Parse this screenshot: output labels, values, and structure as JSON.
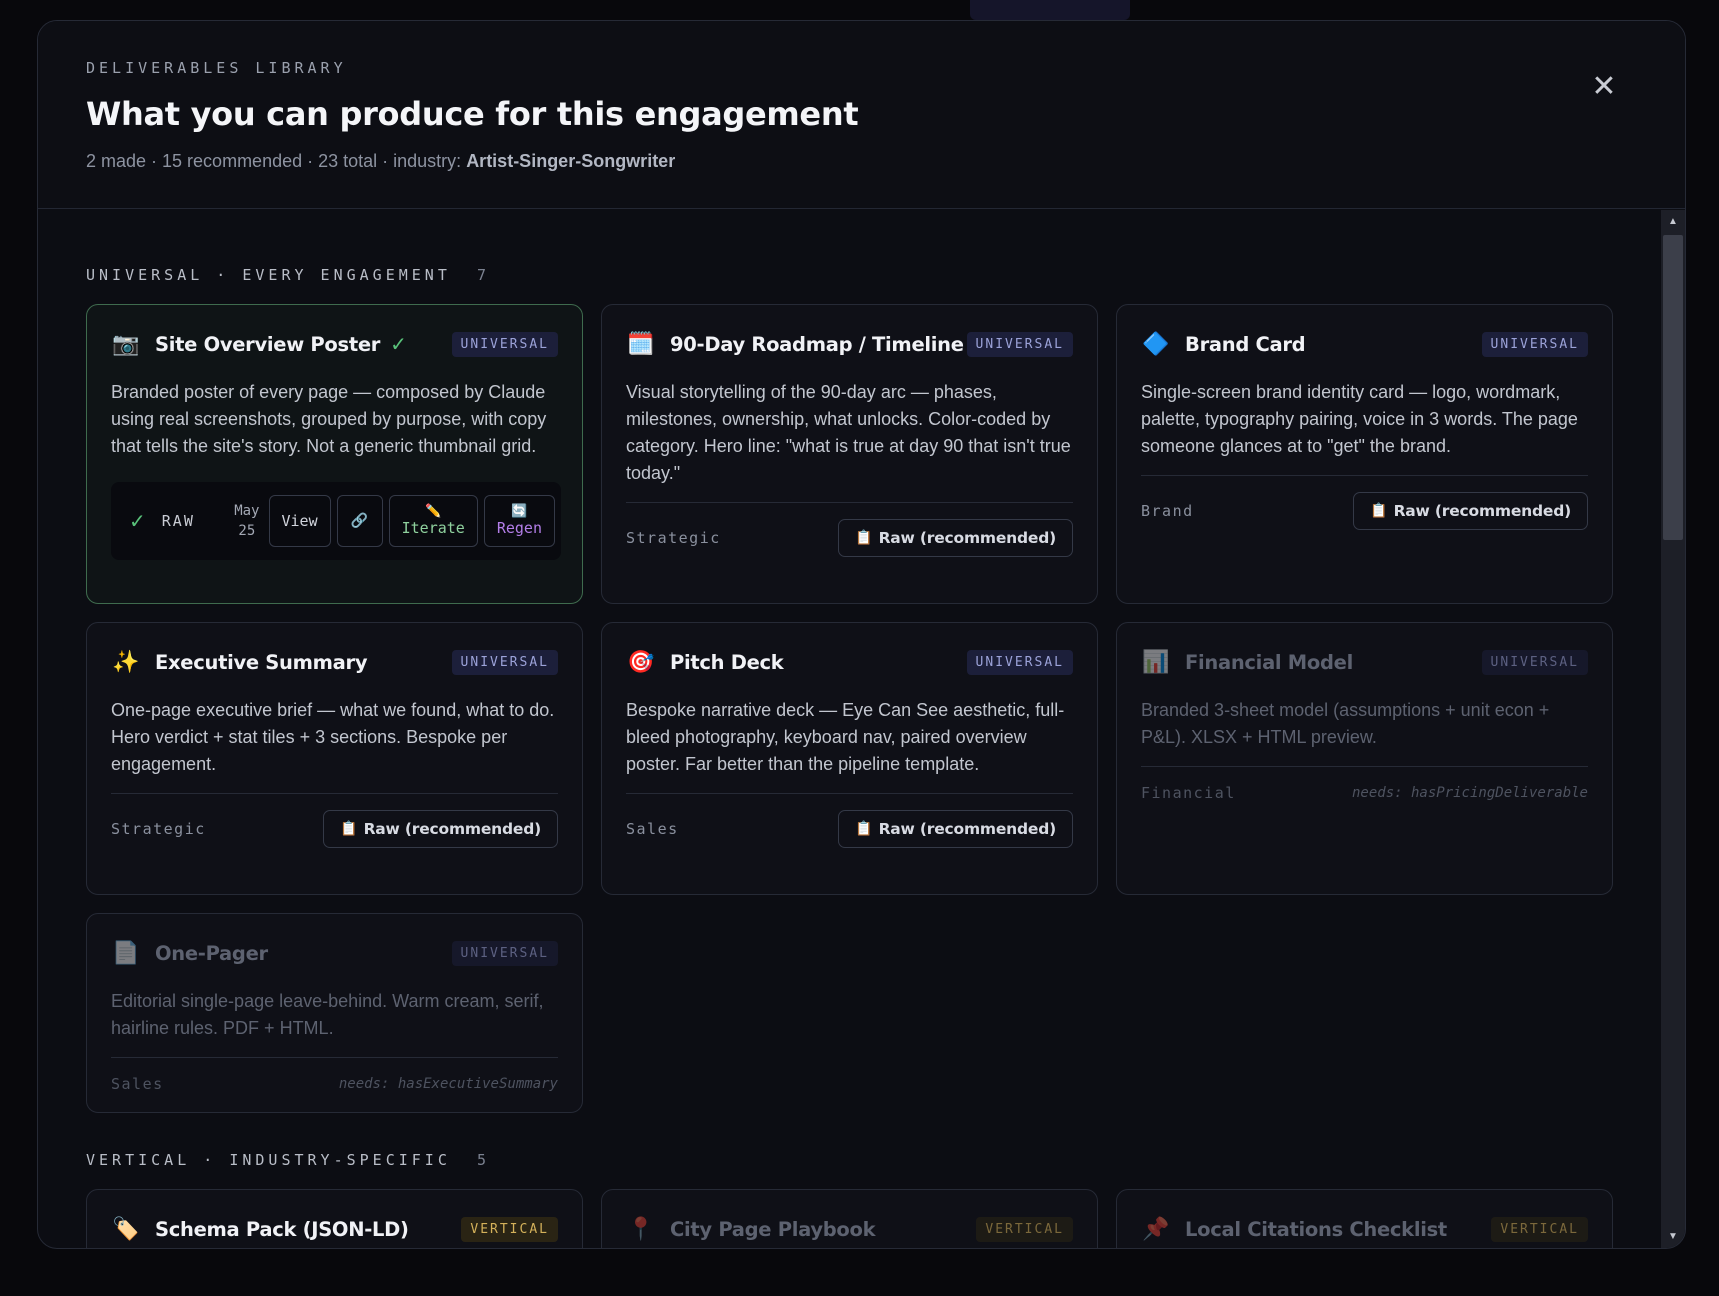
{
  "header": {
    "eyebrow": "DELIVERABLES LIBRARY",
    "title": "What you can produce for this engagement",
    "stats": "2 made · 15 recommended · 23 total · industry: ",
    "industry": "Artist-Singer-Songwriter",
    "close_glyph": "✕"
  },
  "sections": {
    "universal": {
      "label": "UNIVERSAL · EVERY ENGAGEMENT",
      "count": "7"
    },
    "vertical": {
      "label": "VERTICAL · INDUSTRY-SPECIFIC",
      "count": "5"
    }
  },
  "cards": [
    {
      "icon": "📷",
      "icon_name": "camera-icon",
      "title": "Site Overview Poster",
      "check": "✓",
      "tag": "UNIVERSAL",
      "desc": "Branded poster of every page — composed by Claude using real screenshots, grouped by purpose, with copy that tells the site's story. Not a generic thumbnail grid.",
      "made": {
        "check": "✓",
        "label": "RAW",
        "date_month": "May",
        "date_day": "25",
        "view": "View",
        "link_glyph": "🔗",
        "iterate_glyph": "✏️",
        "iterate": "Iterate",
        "regen_glyph": "🔄",
        "regen": "Regen"
      }
    },
    {
      "icon": "🗓️",
      "icon_name": "calendar-icon",
      "title": "90-Day Roadmap / Timeline",
      "tag": "UNIVERSAL",
      "desc": "Visual storytelling of the 90-day arc — phases, milestones, ownership, what unlocks. Color-coded by category. Hero line: \"what is true at day 90 that isn't true today.\"",
      "category": "Strategic",
      "action": "Raw (recommended)",
      "action_glyph": "📋"
    },
    {
      "icon": "🔷",
      "icon_name": "diamond-icon",
      "title": "Brand Card",
      "tag": "UNIVERSAL",
      "desc": "Single-screen brand identity card — logo, wordmark, palette, typography pairing, voice in 3 words. The page someone glances at to \"get\" the brand.",
      "category": "Brand",
      "action": "Raw (recommended)",
      "action_glyph": "📋"
    },
    {
      "icon": "✨",
      "icon_name": "sparkles-icon",
      "title": "Executive Summary",
      "tag": "UNIVERSAL",
      "desc": "One-page executive brief — what we found, what to do. Hero verdict + stat tiles + 3 sections. Bespoke per engagement.",
      "category": "Strategic",
      "action": "Raw (recommended)",
      "action_glyph": "📋"
    },
    {
      "icon": "🎯",
      "icon_name": "target-icon",
      "title": "Pitch Deck",
      "tag": "UNIVERSAL",
      "desc": "Bespoke narrative deck — Eye Can See aesthetic, full-bleed photography, keyboard nav, paired overview poster. Far better than the pipeline template.",
      "category": "Sales",
      "action": "Raw (recommended)",
      "action_glyph": "📋"
    },
    {
      "icon": "📊",
      "icon_name": "bar-chart-icon",
      "title": "Financial Model",
      "tag": "UNIVERSAL",
      "desc": "Branded 3-sheet model (assumptions + unit econ + P&L). XLSX + HTML preview.",
      "category": "Financial",
      "needs": "needs: hasPricingDeliverable"
    },
    {
      "icon": "📄",
      "icon_name": "document-icon",
      "title": "One-Pager",
      "tag": "UNIVERSAL",
      "desc": "Editorial single-page leave-behind. Warm cream, serif, hairline rules. PDF + HTML.",
      "category": "Sales",
      "needs": "needs: hasExecutiveSummary"
    },
    {
      "icon": "🏷️",
      "icon_name": "label-icon",
      "title": "Schema Pack (JSON-LD)",
      "tag": "VERTICAL"
    },
    {
      "icon": "📍",
      "icon_name": "pin-icon",
      "title": "City Page Playbook",
      "tag": "VERTICAL"
    },
    {
      "icon": "📌",
      "icon_name": "pushpin-icon",
      "title": "Local Citations Checklist",
      "tag": "VERTICAL"
    }
  ]
}
